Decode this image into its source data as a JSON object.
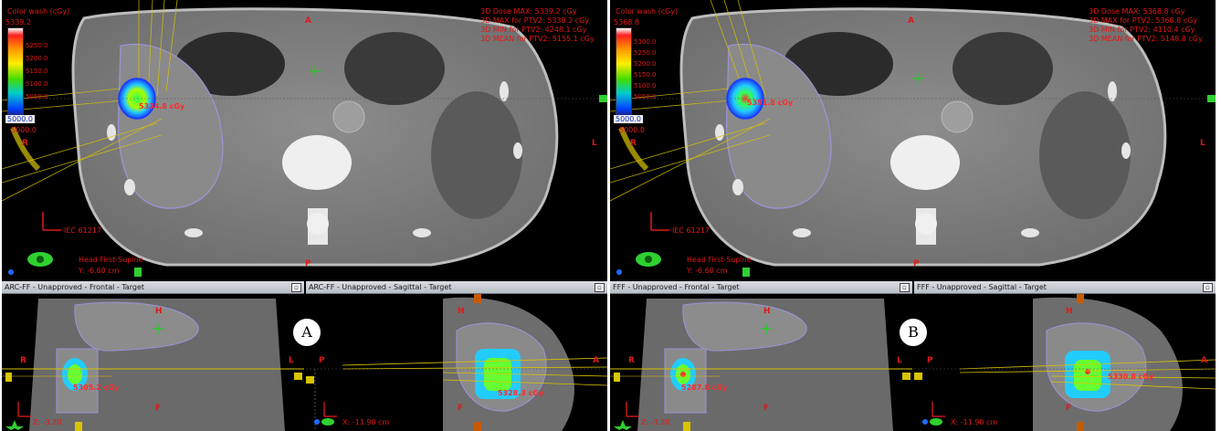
{
  "panels": [
    {
      "id": "A",
      "axial": {
        "colorwash_label": "Color wash (cGy)",
        "colorbar_top": "5339.2",
        "colorbar_ticks": [
          "5250.0",
          "5200.0",
          "5150.0",
          "5100.0",
          "5050.0"
        ],
        "colorbar_bottom": "5000.0",
        "colorbar_min_red": "5000.0",
        "dose_max": "3D Dose MAX: 5339.2 cGy",
        "ptv_max": "3D MAX for PTV2: 5339.2 cGy",
        "ptv_min": "3D MIN for PTV2: 4248.1 cGy",
        "ptv_mean": "3D MEAN for PTV2: 5155.1 cGy",
        "point_dose": "5334.8 cGy",
        "iec": "IEC 61217",
        "orientation": "Head First-Supine",
        "y_coord": "Y: -6.60 cm",
        "label_a": "A",
        "label_l": "L",
        "label_p": "P",
        "label_r": "R"
      },
      "frontal": {
        "title": "ARC-FF - Unapproved - Frontal - Target",
        "label_h": "H",
        "label_r": "R",
        "label_l": "L",
        "label_f": "F",
        "point_dose": "5305.2 cGy",
        "coord": "Z: -3.20"
      },
      "sagittal": {
        "title": "ARC-FF - Unapproved - Sagittal - Target",
        "label_h": "H",
        "label_p": "P",
        "label_a": "A",
        "label_f": "F",
        "point_dose": "5328.3 cGy",
        "coord": "X: -11.90 cm"
      }
    },
    {
      "id": "B",
      "axial": {
        "colorwash_label": "Color wash (cGy)",
        "colorbar_top": "5368.8",
        "colorbar_ticks": [
          "5300.0",
          "5250.0",
          "5200.0",
          "5150.0",
          "5100.0",
          "5050.0"
        ],
        "colorbar_bottom": "5000.0",
        "colorbar_min_red": "5000.0",
        "dose_max": "3D Dose MAX: 5368.8 cGy",
        "ptv_max": "3D MAX for PTV2: 5368.8 cGy",
        "ptv_min": "3D MIN for PTV2: 4110.4 cGy",
        "ptv_mean": "3D MEAN for PTV2: 5148.8 cGy",
        "point_dose": "5351.8 cGy",
        "iec": "IEC 61217",
        "orientation": "Head First-Supine",
        "y_coord": "Y: -6.60 cm",
        "label_a": "A",
        "label_l": "L",
        "label_p": "P",
        "label_r": "R"
      },
      "frontal": {
        "title": "FFF - Unapproved - Frontal - Target",
        "label_h": "H",
        "label_r": "R",
        "label_l": "L",
        "label_f": "F",
        "point_dose": "5287.8 cGy",
        "coord": "Z: -3.20"
      },
      "sagittal": {
        "title": "FFF - Unapproved - Sagittal - Target",
        "label_h": "H",
        "label_p": "P",
        "label_a": "A",
        "label_f": "F",
        "point_dose": "5330.8 cGy",
        "coord": "X: -11.90 cm"
      }
    }
  ],
  "colors": {
    "dose_red": "#e01818",
    "ptv_contour": "#9b94d8",
    "beam_yellow": "#d8c400",
    "isocenter_green": "#22cc22"
  }
}
